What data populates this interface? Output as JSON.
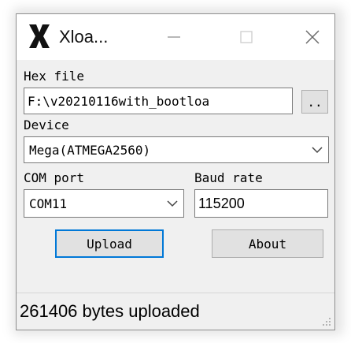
{
  "window": {
    "title": "Xloa...",
    "min_glyph": "—",
    "max_glyph": "☐",
    "close_glyph": "✕",
    "app_icon": "xloader-x-icon"
  },
  "hex": {
    "label": "Hex file",
    "value": "F:\\v20210116with_bootloa",
    "browse_label": ".."
  },
  "device": {
    "label": "Device",
    "selected": "Mega(ATMEGA2560)"
  },
  "com": {
    "label": "COM port",
    "selected": "COM11"
  },
  "baud": {
    "label": "Baud rate",
    "value": "115200"
  },
  "actions": {
    "upload_label": "Upload",
    "about_label": "About"
  },
  "status": {
    "text": "261406 bytes uploaded"
  },
  "colors": {
    "accent": "#0078d7",
    "window_bg": "#f0f0f0",
    "titlebar_bg": "#ffffff"
  }
}
